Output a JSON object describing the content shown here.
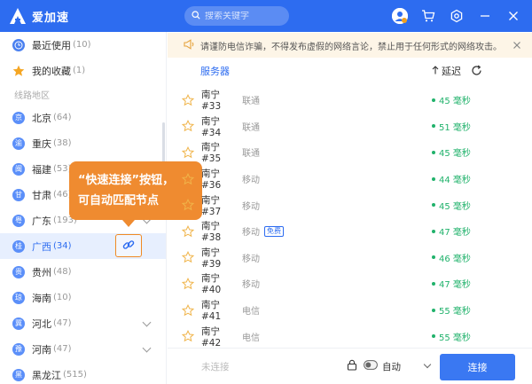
{
  "app": {
    "name": "爱加速"
  },
  "search": {
    "placeholder": "搜索关键字"
  },
  "notice": {
    "text": "请谨防电信诈骗，不得发布虚假的网络言论，禁止用于任何形式的网络攻击。"
  },
  "sidebar": {
    "top_items": [
      {
        "label": "最近使用",
        "count": "(10)",
        "icon": "clock-icon"
      },
      {
        "label": "我的收藏",
        "count": "(1)",
        "icon": "star-icon"
      }
    ],
    "section_label": "线路地区",
    "regions": [
      {
        "label": "北京",
        "count": "(64)",
        "badge": "京",
        "expandable": false
      },
      {
        "label": "重庆",
        "count": "(38)",
        "badge": "渝",
        "expandable": false
      },
      {
        "label": "福建",
        "count": "(53)",
        "badge": "闽",
        "expandable": false
      },
      {
        "label": "甘肃",
        "count": "(46)",
        "badge": "甘",
        "expandable": false
      },
      {
        "label": "广东",
        "count": "(193)",
        "badge": "粤",
        "expandable": true
      },
      {
        "label": "广西",
        "count": "(34)",
        "badge": "桂",
        "expandable": false,
        "active": true
      },
      {
        "label": "贵州",
        "count": "(48)",
        "badge": "贵",
        "expandable": false
      },
      {
        "label": "海南",
        "count": "(10)",
        "badge": "琼",
        "expandable": false
      },
      {
        "label": "河北",
        "count": "(47)",
        "badge": "冀",
        "expandable": true
      },
      {
        "label": "河南",
        "count": "(47)",
        "badge": "豫",
        "expandable": true
      },
      {
        "label": "黑龙江",
        "count": "(515)",
        "badge": "黑",
        "expandable": false
      }
    ]
  },
  "callout": {
    "line1": "“快速连接”按钮，",
    "line2": "可自动匹配节点"
  },
  "list": {
    "header_server": "服务器",
    "header_latency": "延迟",
    "rows": [
      {
        "name": "南宁 #33",
        "isp": "联通",
        "latency": "45 毫秒",
        "tag": ""
      },
      {
        "name": "南宁 #34",
        "isp": "联通",
        "latency": "51 毫秒",
        "tag": ""
      },
      {
        "name": "南宁 #35",
        "isp": "联通",
        "latency": "45 毫秒",
        "tag": ""
      },
      {
        "name": "南宁 #36",
        "isp": "移动",
        "latency": "44 毫秒",
        "tag": ""
      },
      {
        "name": "南宁 #37",
        "isp": "移动",
        "latency": "45 毫秒",
        "tag": ""
      },
      {
        "name": "南宁 #38",
        "isp": "移动",
        "latency": "47 毫秒",
        "tag": "免费"
      },
      {
        "name": "南宁 #39",
        "isp": "移动",
        "latency": "46 毫秒",
        "tag": ""
      },
      {
        "name": "南宁 #40",
        "isp": "移动",
        "latency": "47 毫秒",
        "tag": ""
      },
      {
        "name": "南宁 #41",
        "isp": "电信",
        "latency": "55 毫秒",
        "tag": ""
      },
      {
        "name": "南宁 #42",
        "isp": "电信",
        "latency": "55 毫秒",
        "tag": ""
      }
    ]
  },
  "bottom": {
    "status": "未连接",
    "mode": "自动",
    "connect": "连接"
  },
  "colors": {
    "brand": "#2d6cf0",
    "latency_good": "#20b26b",
    "callout": "#ef8b30",
    "notice_bg": "#fdf5e7"
  }
}
